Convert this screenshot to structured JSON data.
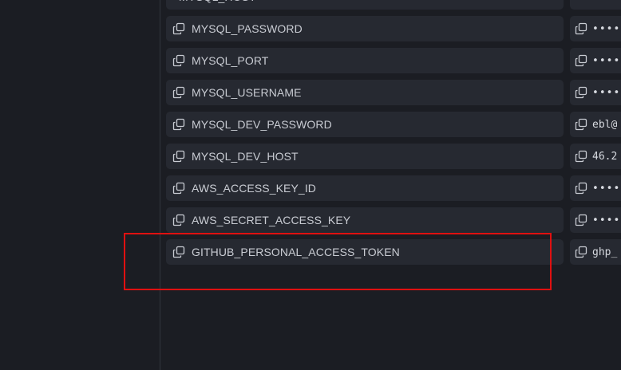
{
  "variables": [
    {
      "key": "MYSQL_HOST",
      "value": "",
      "masked": true,
      "show_icon": false
    },
    {
      "key": "MYSQL_PASSWORD",
      "value": "•••••",
      "masked": true,
      "show_icon": true
    },
    {
      "key": "MYSQL_PORT",
      "value": "•••••",
      "masked": true,
      "show_icon": true
    },
    {
      "key": "MYSQL_USERNAME",
      "value": "•••••",
      "masked": true,
      "show_icon": true
    },
    {
      "key": "MYSQL_DEV_PASSWORD",
      "value": "ebl@",
      "masked": false,
      "show_icon": true
    },
    {
      "key": "MYSQL_DEV_HOST",
      "value": "46.2",
      "masked": false,
      "show_icon": true
    },
    {
      "key": "AWS_ACCESS_KEY_ID",
      "value": "•••••",
      "masked": true,
      "show_icon": true
    },
    {
      "key": "AWS_SECRET_ACCESS_KEY",
      "value": "•••••",
      "masked": true,
      "show_icon": true
    },
    {
      "key": "GITHUB_PERSONAL_ACCESS_TOKEN",
      "value": "ghp_",
      "masked": false,
      "show_icon": true
    }
  ],
  "icons": {
    "copy": "copy-icon"
  },
  "colors": {
    "highlight": "#e01010",
    "background": "#1b1d23",
    "cell": "#262931"
  }
}
